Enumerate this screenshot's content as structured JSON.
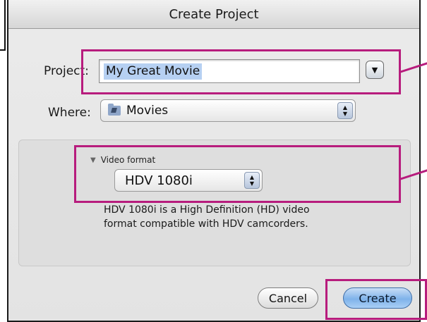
{
  "dialog": {
    "title": "Create Project"
  },
  "project": {
    "label": "Project:",
    "value": "My Great Movie",
    "menu_icon": "disclosure-triangle-down"
  },
  "where": {
    "label": "Where:",
    "selected": "Movies",
    "icon": "movies-folder-icon"
  },
  "video_format": {
    "section_label": "Video format",
    "selected": "HDV 1080i",
    "description": "HDV 1080i is a High Definition (HD) video format compatible with HDV camcorders."
  },
  "buttons": {
    "cancel": "Cancel",
    "create": "Create"
  },
  "highlight_color": "#b71c7d"
}
